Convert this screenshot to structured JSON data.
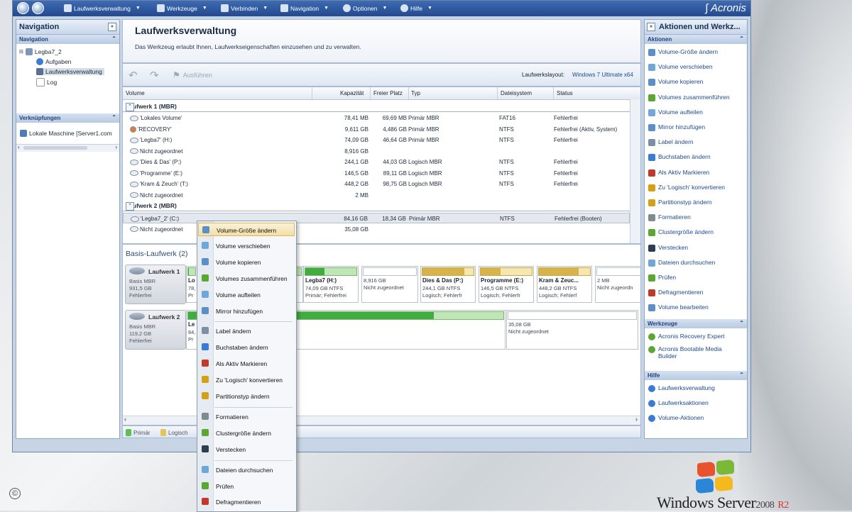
{
  "toolbar": {
    "items": [
      {
        "label": "Laufwerksverwaltung"
      },
      {
        "label": "Werkzeuge"
      },
      {
        "label": "Verbinden"
      },
      {
        "label": "Navigation"
      },
      {
        "label": "Optionen"
      },
      {
        "label": "Hilfe"
      }
    ],
    "brand": "Acronis"
  },
  "left": {
    "title": "Navigation",
    "nav_section": "Navigation",
    "tree": [
      "Legba7_2",
      "Aufgaben",
      "Laufwerksverwaltung",
      "Log"
    ],
    "links_section": "Verknüpfungen",
    "links": [
      "Lokale Maschine [Server1.com"
    ]
  },
  "main": {
    "title": "Laufwerksverwaltung",
    "desc": "Das Werkzeug erlaubt Ihnen, Laufwerkseigenschaften einzusehen und zu verwalten.",
    "run_label": "Ausführen",
    "layout_label": "Laufwerkslayout:",
    "layout_value": "Windows 7 Ultimate x64",
    "columns": [
      "Volume",
      "Kapazität",
      "Freier Platz",
      "Typ",
      "Dateisystem",
      "Status"
    ],
    "groups": [
      {
        "name": "Laufwerk 1 (MBR)",
        "rows": [
          [
            "'Lokales Volume'",
            "78,41 MB",
            "69,69 MB",
            "Primär MBR",
            "FAT16",
            "Fehlerfrei"
          ],
          [
            "'RECOVERY'",
            "9,611 GB",
            "4,486 GB",
            "Primär MBR",
            "NTFS",
            "Fehlerfrei (Aktiv, System)"
          ],
          [
            "'Legba7' (H:)",
            "74,09 GB",
            "46,64 GB",
            "Primär MBR",
            "NTFS",
            "Fehlerfrei"
          ],
          [
            "Nicht zugeordnet",
            "8,916 GB",
            "",
            "",
            "",
            ""
          ],
          [
            "'Dies & Das' (P:)",
            "244,1 GB",
            "44,03 GB",
            "Logisch MBR",
            "NTFS",
            "Fehlerfrei"
          ],
          [
            "'Programme' (E:)",
            "146,5 GB",
            "89,11 GB",
            "Logisch MBR",
            "NTFS",
            "Fehlerfrei"
          ],
          [
            "'Kram & Zeuch' (T:)",
            "448,2 GB",
            "98,75 GB",
            "Logisch MBR",
            "NTFS",
            "Fehlerfrei"
          ],
          [
            "Nicht zugeordnet",
            "2 MB",
            "",
            "",
            "",
            ""
          ]
        ]
      },
      {
        "name": "Laufwerk 2 (MBR)",
        "rows": [
          [
            "'Legba7_2' (C:)",
            "84,16 GB",
            "18,34 GB",
            "Primär MBR",
            "NTFS",
            "Fehlerfrei (Booten)"
          ],
          [
            "Nicht zugeordnet",
            "35,08 GB",
            "",
            "",
            "",
            ""
          ]
        ]
      }
    ],
    "diskmap_title": "Basis-Laufwerk (2)",
    "disk1": {
      "name": "Laufwerk 1",
      "type": "Basis MBR",
      "size": "931,5 GB",
      "status": "Fehlerfrei"
    },
    "disk1_parts": [
      {
        "name": "Lo",
        "l1": "78,",
        "l2": "Pr",
        "fill": 0.11,
        "color": "#3fae3f",
        "bg": "#bfe6b6",
        "border": "#79b86a"
      },
      {
        "name": "",
        "l1": "",
        "l2": "",
        "fill": 0.5,
        "color": "#3fae3f",
        "bg": "#bfe6b6",
        "border": "#79b86a"
      },
      {
        "name": "Legba7 (H:)",
        "l1": "74,09 GB NTFS",
        "l2": "Primär; Fehlerfrei",
        "fill": 0.37,
        "color": "#3fae3f",
        "bg": "#bfe6b6",
        "border": "#79b86a"
      },
      {
        "name": "",
        "l1": "8,916 GB",
        "l2": "Nicht zugeordnet",
        "fill": 0,
        "color": "#fff",
        "bg": "#fff",
        "border": "#b9c2cc"
      },
      {
        "name": "Dies & Das (P:)",
        "l1": "244,1 GB NTFS",
        "l2": "Logisch; Fehlerfr",
        "fill": 0.82,
        "color": "#d8b24a",
        "bg": "#f6e7b0",
        "border": "#c9a646"
      },
      {
        "name": "Programme (E:)",
        "l1": "146,5 GB NTFS",
        "l2": "Logisch; Fehlerfr",
        "fill": 0.39,
        "color": "#d8b24a",
        "bg": "#f6e7b0",
        "border": "#c9a646"
      },
      {
        "name": "Kram & Zeuc...",
        "l1": "448,2 GB NTFS",
        "l2": "Logisch; Fehlerf",
        "fill": 0.78,
        "color": "#d8b24a",
        "bg": "#f6e7b0",
        "border": "#c9a646"
      },
      {
        "name": "",
        "l1": "2 MB",
        "l2": "Nicht zugeordn",
        "fill": 0,
        "color": "#fff",
        "bg": "#fff",
        "border": "#b9c2cc"
      }
    ],
    "disk2": {
      "name": "Laufwerk 2",
      "type": "Basis MBR",
      "size": "119,2 GB",
      "status": "Fehlerfrei"
    },
    "disk2_parts": [
      {
        "name": "Le",
        "l1": "84,",
        "l2": "Pr",
        "fill": 0.78,
        "color": "#3fae3f",
        "bg": "#bfe6b6",
        "border": "#79b86a"
      },
      {
        "name": "",
        "l1": "35,08 GB",
        "l2": "Nicht zugeordnet",
        "fill": 0,
        "color": "#fff",
        "bg": "#fff",
        "border": "#b9c2cc"
      }
    ],
    "legend": [
      "Primär",
      "Logisch"
    ]
  },
  "right": {
    "title": "Aktionen und Werkz...",
    "actions_title": "Aktionen",
    "actions": [
      "Volume-Größe ändern",
      "Volume verschieben",
      "Volume kopieren",
      "Volumes zusammenführen",
      "Volume aufteilen",
      "Mirror hinzufügen",
      "Label ändern",
      "Buchstaben ändern",
      "Als Aktiv Markieren",
      "Zu 'Logisch' konvertieren",
      "Partitionstyp ändern",
      "Formatieren",
      "Clustergröße ändern",
      "Verstecken",
      "Dateien durchsuchen",
      "Prüfen",
      "Defragmentieren",
      "Volume bearbeiten"
    ],
    "tools_title": "Werkzeuge",
    "tools": [
      "Acronis Recovery Expert",
      "Acronis Bootable Media Builder"
    ],
    "help_title": "Hilfe",
    "help": [
      "Laufwerksverwaltung",
      "Laufwerksaktionen",
      "Volume-Aktionen"
    ]
  },
  "context_menu": {
    "items": [
      "Volume-Größe ändern",
      "Volume verschieben",
      "Volume kopieren",
      "Volumes zusammenführen",
      "Volume aufteilen",
      "Mirror hinzufügen",
      "Label ändern",
      "Buchstaben ändern",
      "Als Aktiv Markieren",
      "Zu 'Logisch' konvertieren",
      "Partitionstyp ändern",
      "Formatieren",
      "Clustergröße ändern",
      "Verstecken",
      "Dateien durchsuchen",
      "Prüfen",
      "Defragmentieren"
    ],
    "highlighted": 0
  },
  "desktop": {
    "os_name": "Windows Server",
    "os_version": "2008",
    "os_suffix": "R2",
    "copyright": "©"
  },
  "icon_colors": [
    "#3a7bd5",
    "#5aa832",
    "#c0392b",
    "#d4a017",
    "#2c3e50",
    "#7f8c8d"
  ]
}
